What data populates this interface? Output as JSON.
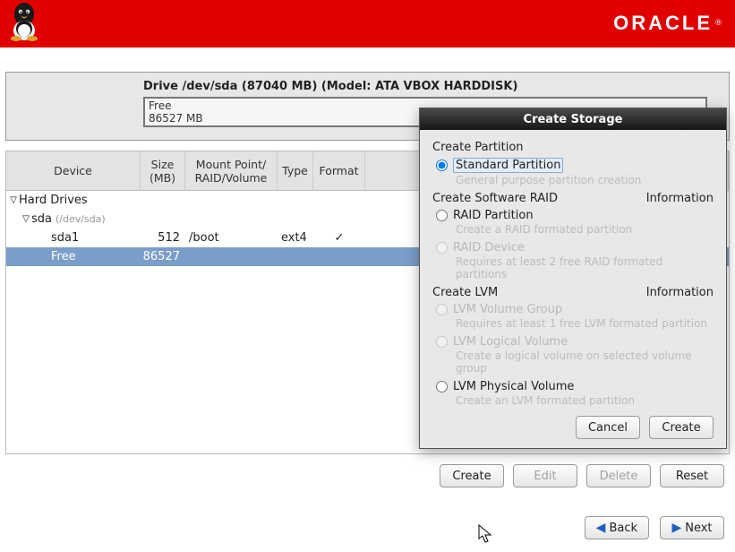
{
  "header": {
    "logo_text": "ORACLE",
    "logo_reg": "®"
  },
  "drive": {
    "title": "Drive /dev/sda (87040 MB) (Model: ATA VBOX HARDDISK)",
    "bar_label": "Free",
    "bar_size": "86527 MB"
  },
  "columns": {
    "device": "Device",
    "size": "Size\n(MB)",
    "mount": "Mount Point/\nRAID/Volume",
    "type": "Type",
    "format": "Format"
  },
  "tree": {
    "root": "Hard Drives",
    "disk": {
      "name": "sda",
      "devpath": "(/dev/sda)"
    },
    "rows": [
      {
        "name": "sda1",
        "size": "512",
        "mount": "/boot",
        "type": "ext4",
        "format": "✓",
        "selected": false
      },
      {
        "name": "Free",
        "size": "86527",
        "mount": "",
        "type": "",
        "format": "",
        "selected": true
      }
    ]
  },
  "buttons": {
    "create": "Create",
    "edit": "Edit",
    "delete": "Delete",
    "reset": "Reset",
    "back": "Back",
    "next": "Next"
  },
  "dialog": {
    "title": "Create Storage",
    "sections": {
      "partition": {
        "title": "Create Partition"
      },
      "raid": {
        "title": "Create Software RAID",
        "info": "Information"
      },
      "lvm": {
        "title": "Create LVM",
        "info": "Information"
      }
    },
    "options": {
      "standard": {
        "label": "Standard Partition",
        "desc": "General purpose partition creation"
      },
      "raid_part": {
        "label": "RAID Partition",
        "desc": "Create a RAID formated partition"
      },
      "raid_dev": {
        "label": "RAID Device",
        "desc": "Requires at least 2 free RAID formated partitions"
      },
      "lvm_vg": {
        "label": "LVM Volume Group",
        "desc": "Requires at least 1 free LVM formated partition"
      },
      "lvm_lv": {
        "label": "LVM Logical Volume",
        "desc": "Create a logical volume on selected volume group"
      },
      "lvm_pv": {
        "label": "LVM Physical Volume",
        "desc": "Create an LVM formated partition"
      }
    },
    "buttons": {
      "cancel": "Cancel",
      "create": "Create"
    }
  }
}
